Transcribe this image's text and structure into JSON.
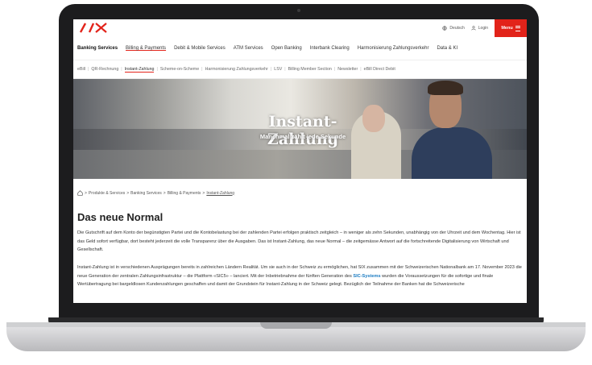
{
  "brand": {
    "logo_text": "SIX",
    "accent": "#e2231a"
  },
  "topbar": {
    "language": "Deutsch",
    "login": "Login",
    "menu": "Menu"
  },
  "nav1": [
    "Banking Services",
    "Billing & Payments",
    "Debit & Mobile Services",
    "ATM Services",
    "Open Banking",
    "Interbank Clearing",
    "Harmonisierung Zahlungsverkehr",
    "Data & KI"
  ],
  "nav2": [
    "eBill",
    "QR-Rechnung",
    "Instant-Zahlung",
    "Scheme-on-Scheme",
    "Harmonisierung Zahlungsverkehr",
    "LSV",
    "Billing Member Section",
    "Newsletter",
    "eBill Direct Debit"
  ],
  "hero": {
    "title": "Instant-Zahlung",
    "subtitle": "Manchmal zählt jede Sekunde"
  },
  "breadcrumb": {
    "items": [
      "Produkte & Services",
      "Banking Services",
      "Billing & Payments"
    ],
    "current": "Instant-Zahlung"
  },
  "article": {
    "heading": "Das neue Normal",
    "p1": "Die Gutschrift auf dem Konto der begünstigten Partei und die Kontobelastung bei der zahlenden Partei erfolgen praktisch zeitgleich – in weniger als zehn Sekunden, unabhängig von der Uhrzeit und dem Wochentag. Hier ist das Geld sofort verfügbar, dort besteht jederzeit die volle Transparenz über die Ausgaben. Das ist Instant-Zahlung, das neue Normal – die zeitgemässe Antwort auf die fortschreitende Digitalisierung von Wirtschaft und Gesellschaft.",
    "p2_before": "Instant-Zahlung ist in verschiedenen Ausprägungen bereits in zahlreichen Ländern Realität. Um sie auch in der Schweiz zu ermöglichen, hat SIX zusammen mit der Schweizerischen Nationalbank am 17. November 2023 die neue Generation der zentralen Zahlungsinfrastruktur – die Plattform «SIC5» – lanciert. Mit der Inbetriebnahme der fünften Generation des ",
    "p2_link": "SIC-Systems",
    "p2_after": " wurden die Voraussetzungen für die sofortige und finale Wertübertragung bei bargeldlosen Kundenzahlungen geschaffen und damit der Grundstein für Instant-Zahlung in der Schweiz gelegt. Bezüglich der Teilnahme der Banken hat die Schweizerische"
  }
}
